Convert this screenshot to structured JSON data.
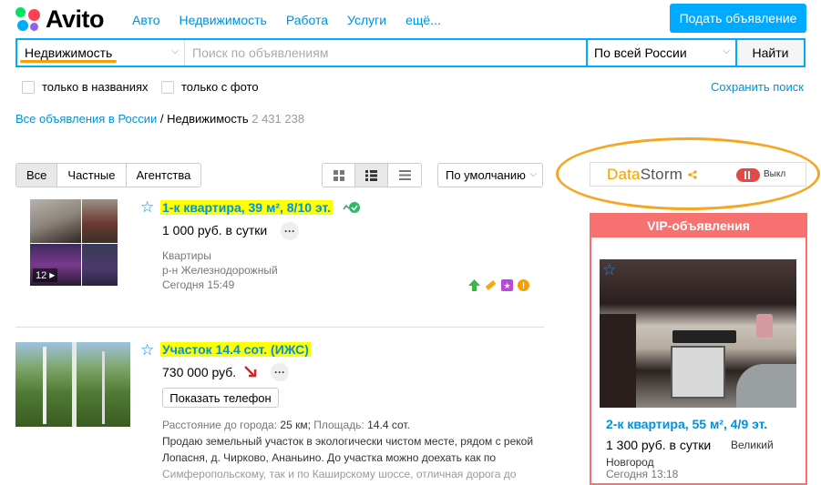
{
  "header": {
    "logo": "Avito",
    "nav": [
      "Авто",
      "Недвижимость",
      "Работа",
      "Услуги",
      "ещё..."
    ],
    "post_button": "Подать объявление"
  },
  "search": {
    "category": "Недвижимость",
    "placeholder": "Поиск по объявлениям",
    "region": "По всей России",
    "find_button": "Найти",
    "only_titles": "только в названиях",
    "only_photo": "только с фото",
    "save_search": "Сохранить поиск"
  },
  "breadcrumb": {
    "root": "Все объявления в России",
    "sep": " / ",
    "current": "Недвижимость",
    "count": "2 431 238"
  },
  "filters": {
    "tabs": [
      "Все",
      "Частные",
      "Агентства"
    ],
    "active_tab": "Все",
    "sort": "По умолчанию"
  },
  "datastorm": {
    "name_a": "Data",
    "name_b": "Storm",
    "toggle_label": "Выкл"
  },
  "listings": [
    {
      "title": "1-к квартира, 39 м², 8/10 эт.",
      "price": "1 000 руб. в сутки",
      "category": "Квартиры",
      "district": "р-н Железнодорожный",
      "date": "Сегодня 15:49",
      "photo_count": "12"
    },
    {
      "title": "Участок 14.4 сот. (ИЖС)",
      "price": "730 000 руб.",
      "phone_button": "Показать телефон",
      "dist_label": "Расстояние до города:",
      "dist_value": "25 км",
      "area_label": "Площадь:",
      "area_value": "14.4 сот.",
      "desc_1": "Продаю земельный участок в экологически чистом месте, рядом с рекой",
      "desc_2": "Лопасня, д. Чирково, Ананьино. До участка можно доехать как по",
      "desc_3": "Симферопольскому, так и по Каширскому шоссе, отличная дорога до"
    }
  ],
  "vip": {
    "header": "VIP-объявления",
    "title": "2-к квартира, 55 м², 4/9 эт.",
    "price": "1 300 руб. в сутки",
    "location": "Великий",
    "location2": "Новгород",
    "date": "Сегодня 13:18"
  },
  "colors": {
    "accent": "#00aaff",
    "link": "#0091d9",
    "highlight": "#ffff00",
    "vip": "#f87171",
    "annotation": "#f5a623"
  }
}
